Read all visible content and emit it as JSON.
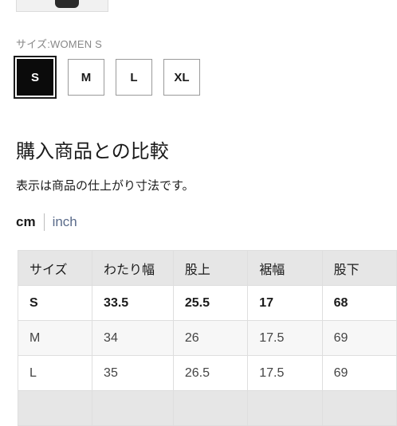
{
  "size_label": "サイズ:WOMEN S",
  "sizes": [
    {
      "label": "S",
      "selected": true
    },
    {
      "label": "M",
      "selected": false
    },
    {
      "label": "L",
      "selected": false
    },
    {
      "label": "XL",
      "selected": false
    }
  ],
  "comparison": {
    "title": "購入商品との比較",
    "note": "表示は商品の仕上がり寸法です。"
  },
  "units": {
    "cm": "cm",
    "inch": "inch",
    "active": "cm"
  },
  "table": {
    "headers": [
      "サイズ",
      "わたり幅",
      "股上",
      "裾幅",
      "股下"
    ],
    "rows": [
      [
        "S",
        "33.5",
        "25.5",
        "17",
        "68"
      ],
      [
        "M",
        "34",
        "26",
        "17.5",
        "69"
      ],
      [
        "L",
        "35",
        "26.5",
        "17.5",
        "69"
      ]
    ]
  }
}
